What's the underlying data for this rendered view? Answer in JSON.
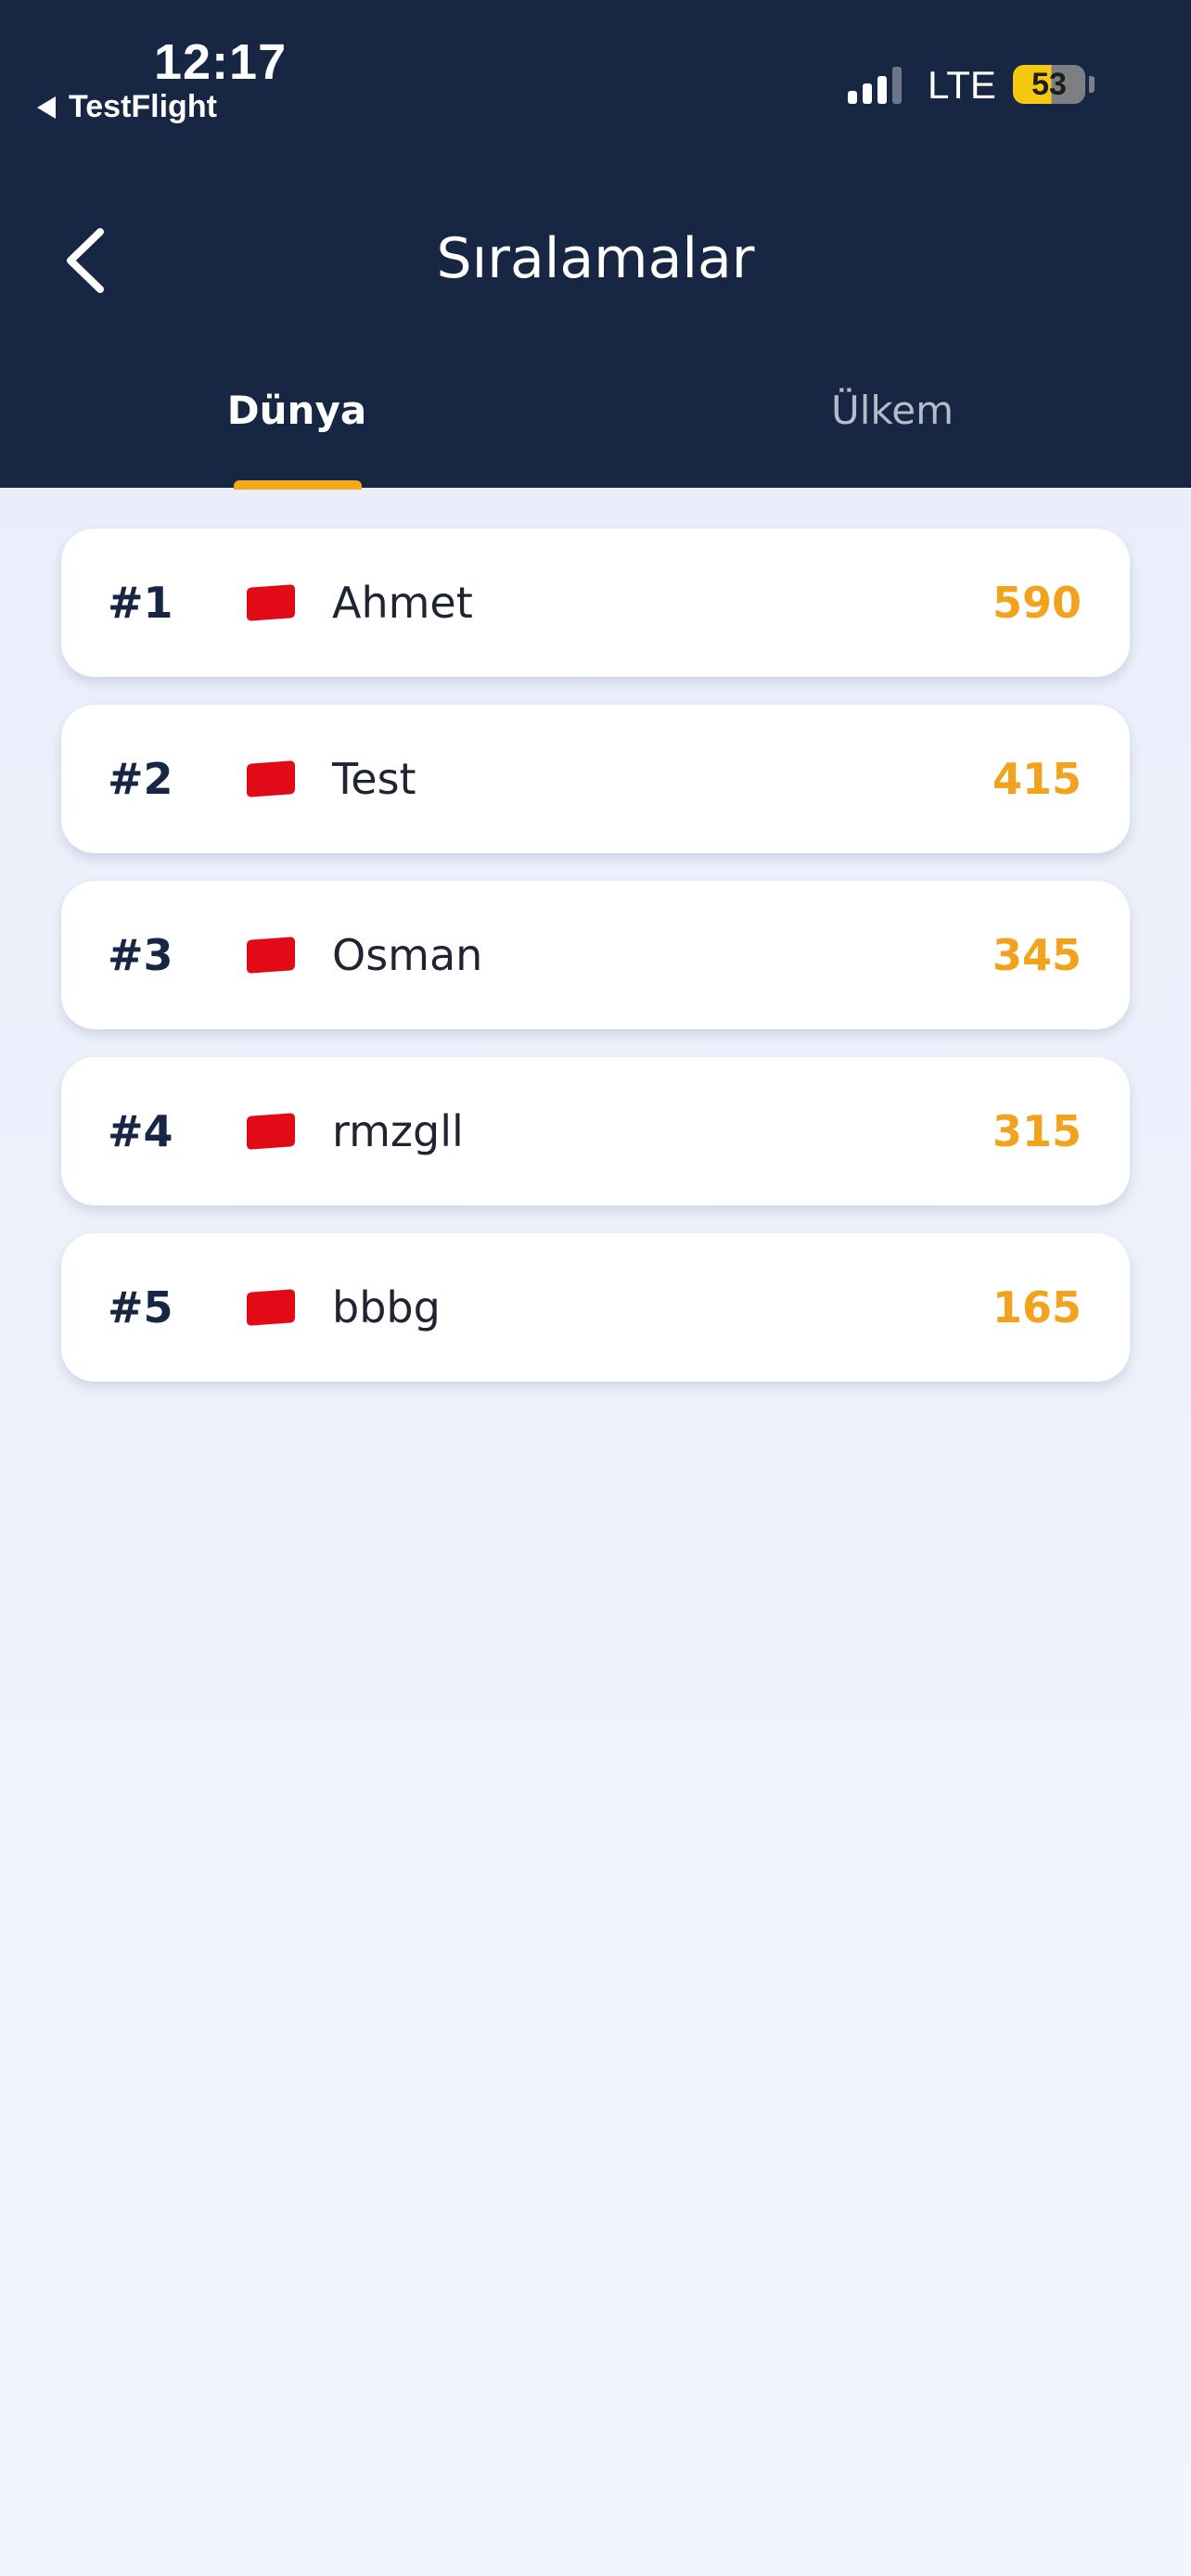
{
  "status_bar": {
    "time": "12:17",
    "back_app": "TestFlight",
    "network": "LTE",
    "battery": "53"
  },
  "nav": {
    "title": "Sıralamalar",
    "back_icon": "chevron-left-icon"
  },
  "tabs": [
    {
      "label": "Dünya",
      "active": true
    },
    {
      "label": "Ülkem",
      "active": false
    }
  ],
  "leaderboard": [
    {
      "rank": "#1",
      "flag": "turkey-flag-icon",
      "name": "Ahmet",
      "score": "590"
    },
    {
      "rank": "#2",
      "flag": "turkey-flag-icon",
      "name": "Test",
      "score": "415"
    },
    {
      "rank": "#3",
      "flag": "turkey-flag-icon",
      "name": "Osman",
      "score": "345"
    },
    {
      "rank": "#4",
      "flag": "turkey-flag-icon",
      "name": "rmzgll",
      "score": "315"
    },
    {
      "rank": "#5",
      "flag": "turkey-flag-icon",
      "name": "bbbg",
      "score": "165"
    }
  ],
  "colors": {
    "header_bg": "#172642",
    "accent": "#f2a91e",
    "score": "#f2a31e",
    "card_bg": "#ffffff"
  }
}
